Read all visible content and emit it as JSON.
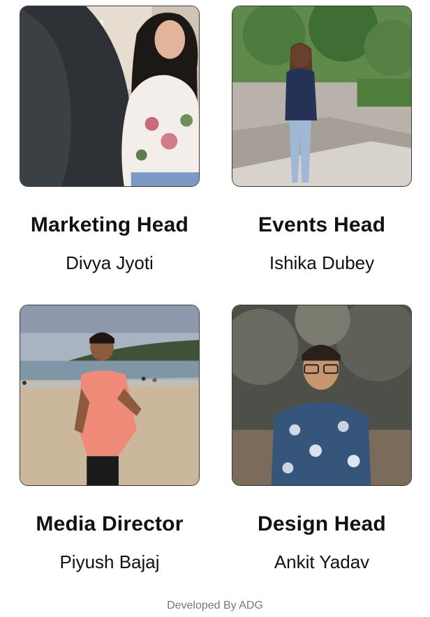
{
  "members": [
    {
      "role": "Marketing Head",
      "name": "Divya Jyoti",
      "photo_icon": "person-photo-icon"
    },
    {
      "role": "Events Head",
      "name": "Ishika Dubey",
      "photo_icon": "person-photo-icon"
    },
    {
      "role": "Media Director",
      "name": "Piyush Bajaj",
      "photo_icon": "person-photo-icon"
    },
    {
      "role": "Design Head",
      "name": "Ankit Yadav",
      "photo_icon": "person-photo-icon"
    }
  ],
  "footer": {
    "text": "Developed By ADG"
  }
}
